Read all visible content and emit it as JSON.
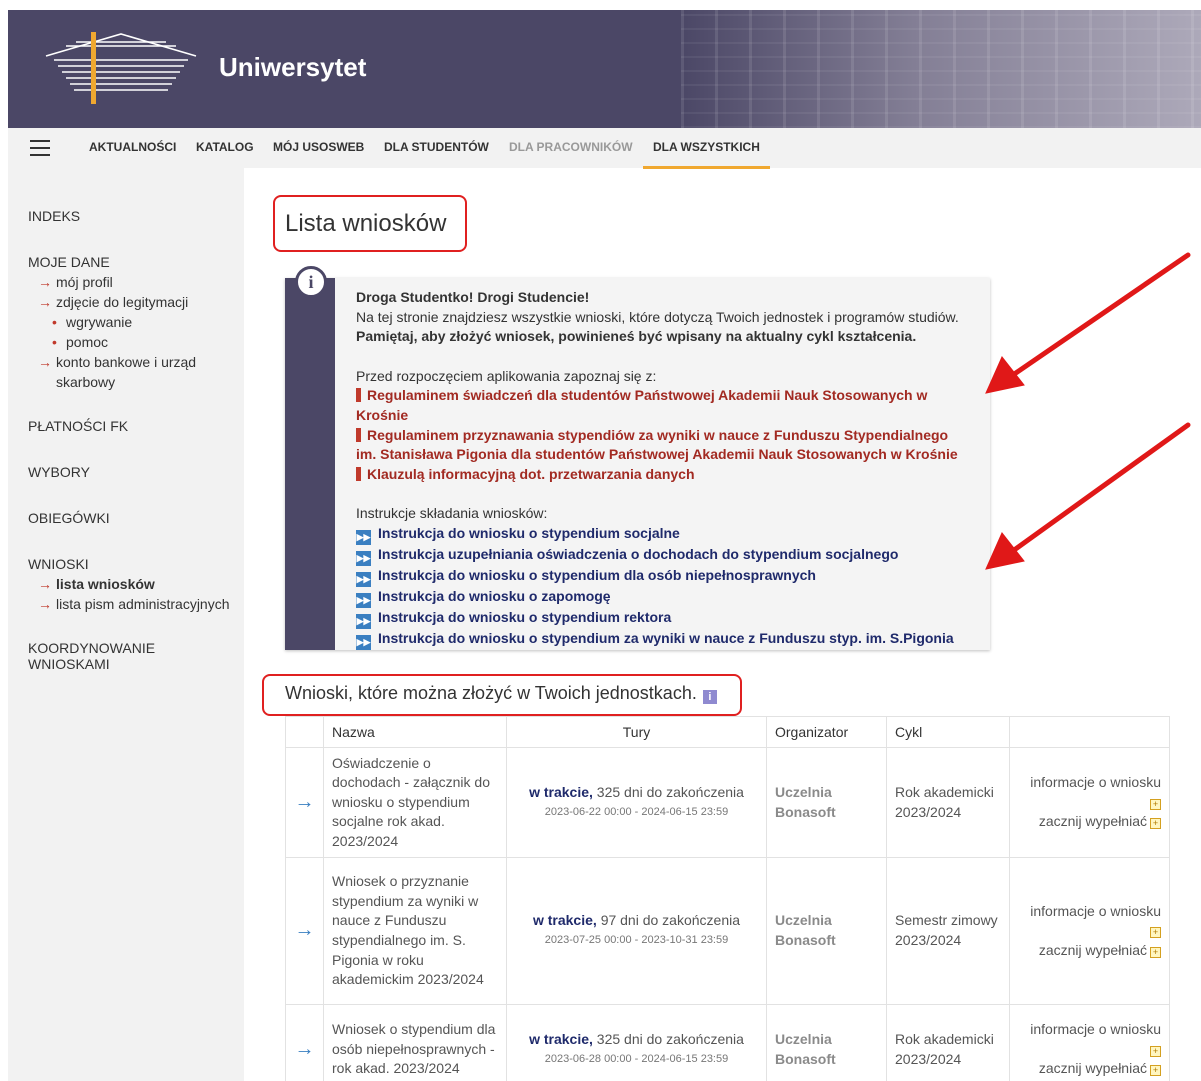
{
  "header": {
    "title": "Uniwersytet"
  },
  "nav": {
    "items": [
      {
        "label": "AKTUALNOŚCI"
      },
      {
        "label": "KATALOG"
      },
      {
        "label": "MÓJ USOSWEB"
      },
      {
        "label": "DLA STUDENTÓW"
      },
      {
        "label": "DLA PRACOWNIKÓW"
      },
      {
        "label": "DLA WSZYSTKICH"
      }
    ],
    "active": "DLA WSZYSTKICH"
  },
  "sidebar": {
    "indeks": "INDEKS",
    "moje_dane": {
      "label": "MOJE DANE",
      "items": [
        "mój profil",
        "zdjęcie do legitymacji",
        "wgrywanie",
        "pomoc",
        "konto bankowe i urząd skarbowy"
      ]
    },
    "platnosci": "PŁATNOŚCI FK",
    "wybory": "WYBORY",
    "obiegowki": "OBIEGÓWKI",
    "wnioski": {
      "label": "WNIOSKI",
      "items": [
        "lista wniosków",
        "lista pism administracyjnych"
      ]
    },
    "koordynowanie": "KOORDYNOWANIE WNIOSKAMI"
  },
  "page": {
    "title": "Lista wniosków"
  },
  "info": {
    "greeting": "Droga Studentko! Drogi Studencie!",
    "intro": "Na tej stronie znajdziesz wszystkie wnioski, które dotyczą Twoich jednostek i programów studiów.",
    "remember": "Pamiętaj, aby złożyć wniosek, powinieneś być wpisany na aktualny cykl kształcenia.",
    "before": "Przed rozpoczęciem aplikowania zapoznaj się z:",
    "regs": [
      "Regulaminem świadczeń dla studentów Państwowej Akademii Nauk Stosowanych w Krośnie",
      "Regulaminem przyznawania stypendiów za wyniki w nauce z Funduszu Stypendialnego im. Stanisława Pigonia dla studentów Państwowej Akademii Nauk Stosowanych w Krośnie",
      "Klauzulą informacyjną dot. przetwarzania danych"
    ],
    "instr_head": "Instrukcje składania wniosków:",
    "instructions": [
      "Instrukcja do wniosku o stypendium socjalne",
      "Instrukcja uzupełniania oświadczenia o dochodach do stypendium socjalnego",
      "Instrukcja do wniosku o stypendium dla osób niepełnosprawnych",
      "Instrukcja do wniosku o zapomogę",
      "Instrukcja do wniosku o stypendium rektora",
      "Instrukcja do wniosku o stypendium za wyniki w nauce z Funduszu styp. im. S.Pigonia"
    ]
  },
  "section": {
    "title": "Wnioski, które można złożyć w Twoich jednostkach."
  },
  "table": {
    "headers": [
      "Nazwa",
      "Tury",
      "Organizator",
      "Cykl"
    ],
    "rows": [
      {
        "name": "Oświadczenie o dochodach - załącznik do wniosku o stypendium socjalne rok akad. 2023/2024",
        "status": "w trakcie,",
        "days": "325 dni do zakończenia",
        "range": "2023-06-22 00:00 - 2024-06-15 23:59",
        "org": "Uczelnia Bonasoft",
        "cykl": "Rok akademicki 2023/2024",
        "info": "informacje o wniosku",
        "start": "zacznij wypełniać"
      },
      {
        "name": "Wniosek o przyznanie stypendium za wyniki w nauce z Funduszu stypendialnego im. S. Pigonia w roku akademickim 2023/2024",
        "status": "w trakcie,",
        "days": "97 dni do zakończenia",
        "range": "2023-07-25 00:00 - 2023-10-31 23:59",
        "org": "Uczelnia Bonasoft",
        "cykl": "Semestr zimowy 2023/2024",
        "info": "informacje o wniosku",
        "start": "zacznij wypełniać"
      },
      {
        "name": "Wniosek o stypendium dla osób niepełnosprawnych - rok akad. 2023/2024",
        "status": "w trakcie,",
        "days": "325 dni do zakończenia",
        "range": "2023-06-28 00:00 - 2024-06-15 23:59",
        "org": "Uczelnia Bonasoft",
        "cykl": "Rok akademicki 2023/2024",
        "info": "informacje o wniosku",
        "start": "zacznij wypełniać"
      }
    ]
  },
  "colors": {
    "header_bg": "#4b4766",
    "accent": "#f0a830",
    "link": "#1f2a6b",
    "warning": "#a22a22",
    "highlight": "#e02020"
  }
}
